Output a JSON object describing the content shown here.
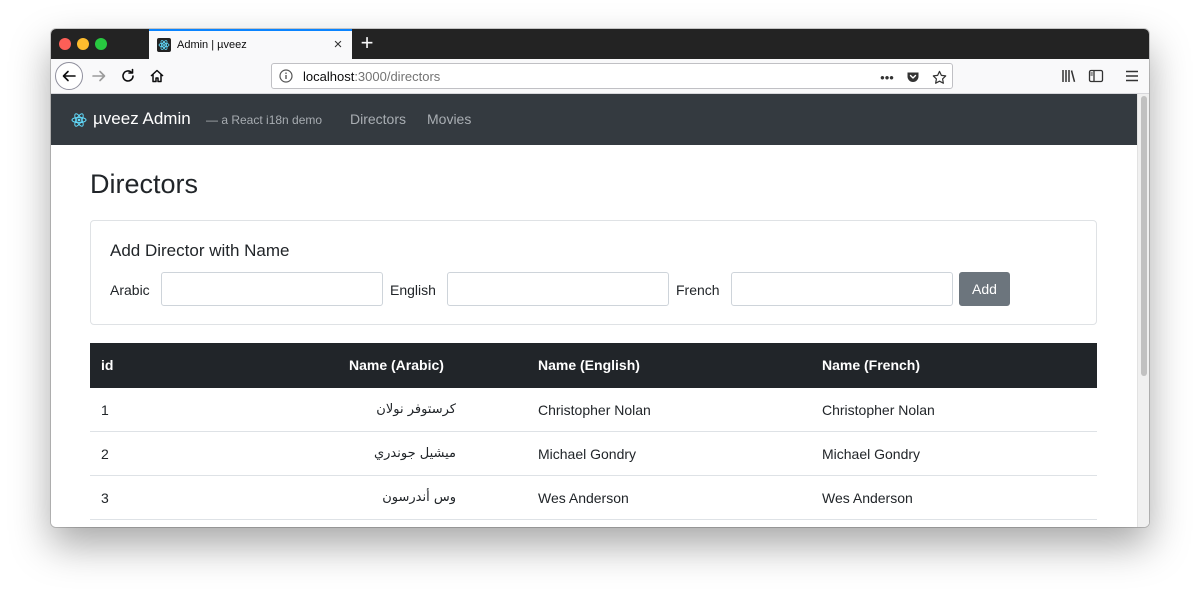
{
  "browser": {
    "tab_title": "Admin | µveez",
    "url_host": "localhost",
    "url_path": ":3000/directors"
  },
  "app": {
    "brand": "µveez Admin",
    "tagline": "— a React i18n demo",
    "nav": [
      "Directors",
      "Movies"
    ]
  },
  "page": {
    "title": "Directors"
  },
  "form": {
    "title": "Add Director with Name",
    "fields": [
      {
        "label": "Arabic",
        "value": ""
      },
      {
        "label": "English",
        "value": ""
      },
      {
        "label": "French",
        "value": ""
      }
    ],
    "submit_label": "Add"
  },
  "table": {
    "headers": [
      "id",
      "Name (Arabic)",
      "Name (English)",
      "Name (French)"
    ],
    "rows": [
      {
        "id": "1",
        "arabic": "كرستوفر نولان",
        "english": "Christopher Nolan",
        "french": "Christopher Nolan"
      },
      {
        "id": "2",
        "arabic": "ميشيل جوندري",
        "english": "Michael Gondry",
        "french": "Michael Gondry"
      },
      {
        "id": "3",
        "arabic": "وس أندرسون",
        "english": "Wes Anderson",
        "french": "Wes Anderson"
      }
    ]
  },
  "colors": {
    "navbar_bg": "#343a40",
    "table_header_bg": "#212529",
    "button_secondary": "#6c757d",
    "tab_accent": "#0a84ff"
  },
  "icons": [
    "react-logo-icon",
    "back-arrow-icon",
    "forward-arrow-icon",
    "reload-icon",
    "home-icon",
    "info-icon",
    "more-icon",
    "pocket-icon",
    "bookmark-star-icon",
    "library-icon",
    "sidebar-icon",
    "hamburger-menu-icon",
    "close-icon",
    "plus-icon"
  ]
}
